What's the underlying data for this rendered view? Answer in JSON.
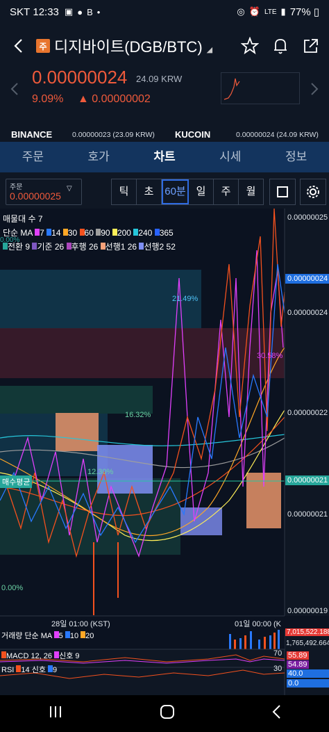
{
  "status": {
    "carrier": "SKT",
    "time": "12:33",
    "network": "LTE",
    "battery": "77%"
  },
  "header": {
    "badge": "주",
    "title": "디지바이트(DGB/BTC)"
  },
  "price": {
    "current": "0.00000024",
    "krw": "24.09 KRW",
    "change_pct": "9.09%",
    "change_abs": "▲ 0.00000002"
  },
  "exchanges": [
    {
      "name": "BINANCE",
      "value": "0.00000023 (23.09 KRW)"
    },
    {
      "name": "KUCOIN",
      "value": "0.00000024 (24.09 KRW)"
    }
  ],
  "tabs": [
    "주문",
    "호가",
    "차트",
    "시세",
    "정보"
  ],
  "controls": {
    "order_label": "주문",
    "order_value": "0.00000025",
    "intervals": [
      "틱",
      "초",
      "60분",
      "일",
      "주",
      "월"
    ]
  },
  "legend": {
    "volume_profile": "매물대 수 7",
    "ma_label": "단순 MA",
    "ma": [
      {
        "p": "7",
        "c": "#e040fb"
      },
      {
        "p": "14",
        "c": "#2979ff"
      },
      {
        "p": "30",
        "c": "#ffa726"
      },
      {
        "p": "60",
        "c": "#f4511e"
      },
      {
        "p": "90",
        "c": "#9e9e9e"
      },
      {
        "p": "200",
        "c": "#ffee58"
      },
      {
        "p": "240",
        "c": "#26c6da"
      },
      {
        "p": "365",
        "c": "#2962ff"
      }
    ],
    "ichimoku": [
      {
        "t": "전환 9",
        "c": "#26a69a"
      },
      {
        "t": "기준 26",
        "c": "#7e57c2"
      },
      {
        "t": "후행 26",
        "c": "#ab47bc"
      },
      {
        "t": "선행1 26",
        "c": "#f7a17a"
      },
      {
        "t": "선행2 52",
        "c": "#7f8ff4"
      }
    ],
    "overlap_pct": "0.00%"
  },
  "yaxis": [
    "0.00000025",
    "0.00000024",
    "0.00000024",
    "0.00000022",
    "0.00000021",
    "0.00000021",
    "0.00000019"
  ],
  "price_tag": "0.00000024",
  "avg_tag": "0.00000021",
  "avg_label": "매수평균",
  "profile_pcts": [
    "21.49%",
    "30.58%",
    "16.32%",
    "12.30%",
    "0.00%"
  ],
  "xaxis": [
    "28일 01:00 (KST)",
    "01일 00:00 (K"
  ],
  "volume": {
    "label": "거래량 단순 MA",
    "ma": [
      {
        "p": "5",
        "c": "#e040fb"
      },
      {
        "p": "10",
        "c": "#2979ff"
      },
      {
        "p": "20",
        "c": "#ffa726"
      }
    ],
    "max": "7,015,522.188",
    "val": "1,765,492.664"
  },
  "macd": {
    "label": "MACD 12, 26",
    "signal": "신호 9",
    "val1": "55.89",
    "val2": "54.89"
  },
  "rsi": {
    "label": "RSI",
    "params": "14 신호",
    "signal": "9",
    "l70": "70",
    "l30": "30",
    "val": "40.0",
    "val2": "0.0"
  }
}
